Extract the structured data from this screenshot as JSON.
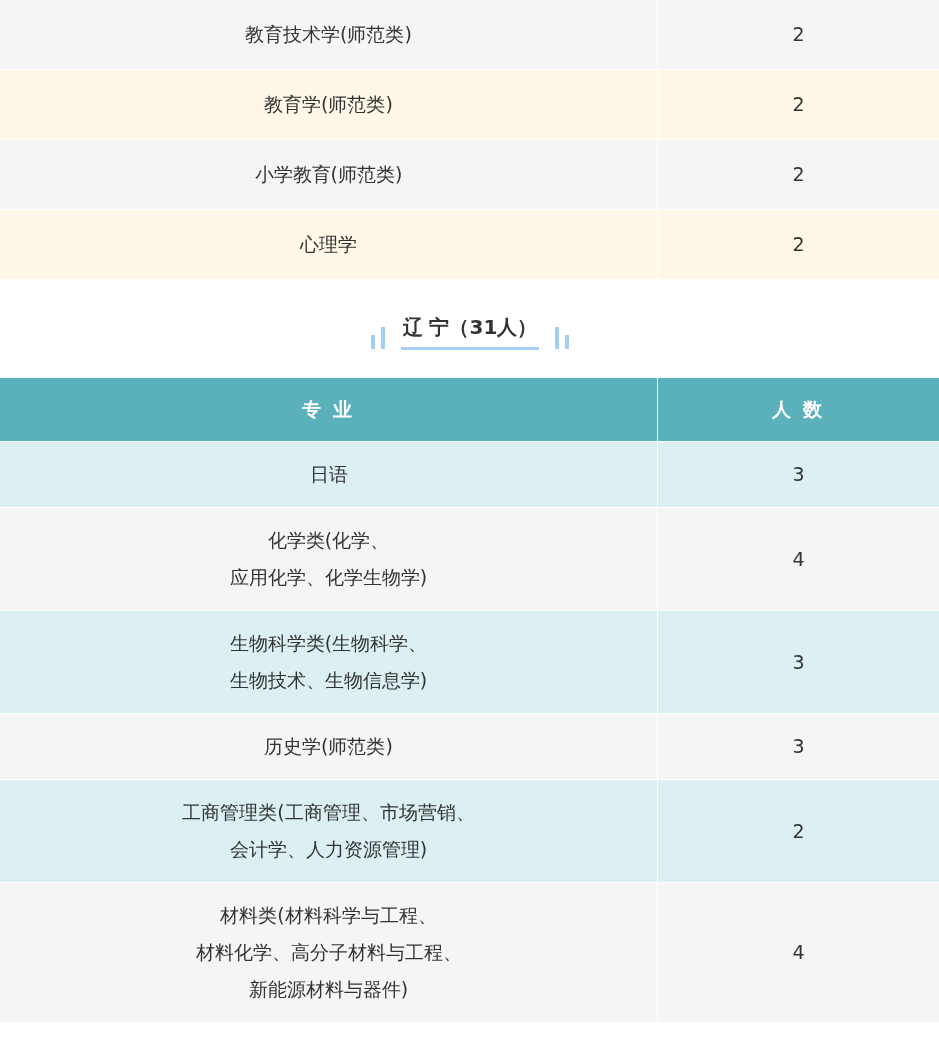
{
  "table_1": {
    "rows": [
      {
        "major": "教育技术学(师范类)",
        "count": "2"
      },
      {
        "major": "教育学(师范类)",
        "count": "2"
      },
      {
        "major": "小学教育(师范类)",
        "count": "2"
      },
      {
        "major": "心理学",
        "count": "2"
      }
    ]
  },
  "section": {
    "title": "辽 宁（31人）"
  },
  "table_2": {
    "columns": [
      "专 业",
      "人 数"
    ],
    "rows": [
      {
        "major": "日语",
        "count": "3"
      },
      {
        "major": [
          "化学类(化学、",
          "应用化学、化学生物学)"
        ],
        "count": "4"
      },
      {
        "major": [
          "生物科学类(生物科学、",
          "生物技术、生物信息学)"
        ],
        "count": "3"
      },
      {
        "major": "历史学(师范类)",
        "count": "3"
      },
      {
        "major": [
          "工商管理类(工商管理、市场营销、",
          "会计学、人力资源管理)"
        ],
        "count": "2"
      },
      {
        "major": [
          "材料类(材料科学与工程、",
          "材料化学、高分子材料与工程、",
          "新能源材料与器件)"
        ],
        "count": "4"
      }
    ]
  }
}
